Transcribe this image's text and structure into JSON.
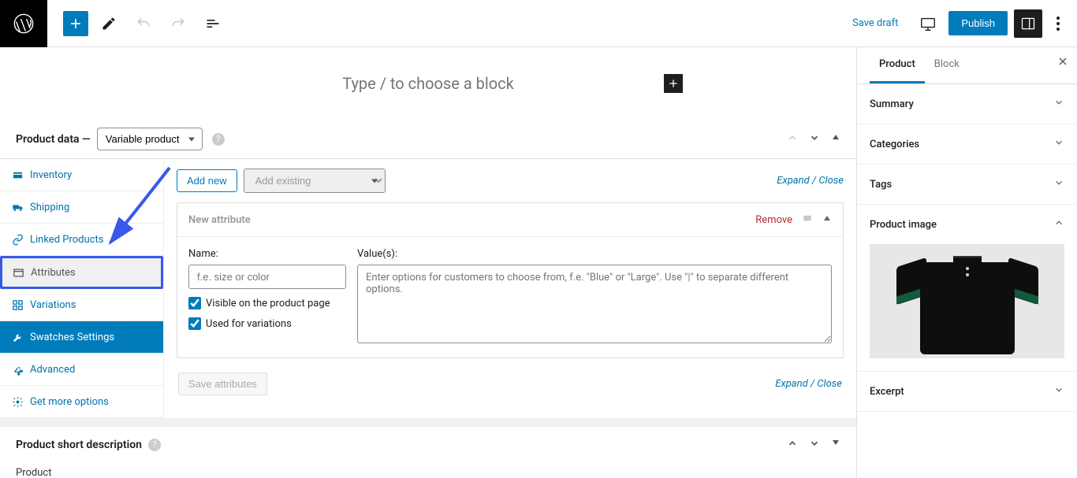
{
  "topbar": {
    "save_draft": "Save draft",
    "publish": "Publish"
  },
  "block_placeholder": "Type / to choose a block",
  "product_data": {
    "title": "Product data —",
    "type_selected": "Variable product",
    "tabs": {
      "inventory": "Inventory",
      "shipping": "Shipping",
      "linked_products": "Linked Products",
      "attributes": "Attributes",
      "variations": "Variations",
      "swatches": "Swatches Settings",
      "advanced": "Advanced",
      "get_more": "Get more options"
    },
    "attributes_panel": {
      "add_new": "Add new",
      "add_existing_placeholder": "Add existing",
      "expand_collapse": "Expand / Close",
      "new_attribute": "New attribute",
      "remove": "Remove",
      "name_label": "Name:",
      "name_placeholder": "f.e. size or color",
      "values_label": "Value(s):",
      "values_placeholder": "Enter options for customers to choose from, f.e. \"Blue\" or \"Large\". Use \"|\" to separate different options.",
      "visible_label": "Visible on the product page",
      "used_label": "Used for variations",
      "save_attributes": "Save attributes"
    }
  },
  "short_description_title": "Product short description",
  "bottom_product": "Product",
  "sidebar": {
    "tabs": {
      "product": "Product",
      "block": "Block"
    },
    "sections": {
      "summary": "Summary",
      "categories": "Categories",
      "tags": "Tags",
      "product_image": "Product image",
      "excerpt": "Excerpt"
    }
  }
}
